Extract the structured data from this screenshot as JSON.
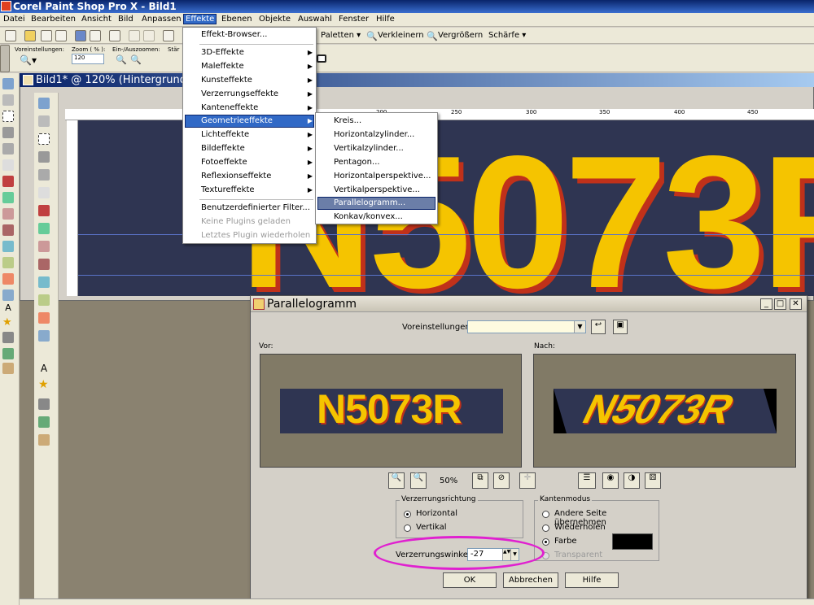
{
  "app": {
    "title": "Corel Paint Shop Pro X - Bild1"
  },
  "menubar": [
    "Datei",
    "Bearbeiten",
    "Ansicht",
    "Bild",
    "Anpassen",
    "Effekte",
    "Ebenen",
    "Objekte",
    "Auswahl",
    "Fenster",
    "Hilfe"
  ],
  "toolbar1": {
    "paletten": "Paletten ▾",
    "verkleinern": "Verkleinern",
    "vergroessern": "Vergrößern",
    "schaerfe": "Schärfe ▾"
  },
  "toolbar2": {
    "presets_label": "Voreinstellungen:",
    "zoom_label": "Zoom ( % ):",
    "zoom_value": "120",
    "zoominout_label": "Ein-/Auszoomen:",
    "staerke_label": "Stär"
  },
  "document": {
    "title": "Bild1* @ 120% (Hintergrund",
    "plate_text": "N5073R"
  },
  "ruler_ticks": [
    "200",
    "250",
    "300",
    "350",
    "400",
    "450"
  ],
  "effects_menu": {
    "items": [
      "Effekt-Browser...",
      "3D-Effekte",
      "Maleffekte",
      "Kunsteffekte",
      "Verzerrungseffekte",
      "Kanteneffekte",
      "Geometrieeffekte",
      "Lichteffekte",
      "Bildeffekte",
      "Fotoeffekte",
      "Reflexionseffekte",
      "Textureffekte",
      "Benutzerdefinierter Filter...",
      "Keine Plugins geladen",
      "Letztes Plugin wiederholen"
    ]
  },
  "geometry_menu": {
    "items": [
      "Kreis...",
      "Horizontalzylinder...",
      "Vertikalzylinder...",
      "Pentagon...",
      "Horizontalperspektive...",
      "Vertikalperspektive...",
      "Parallelogramm...",
      "Konkav/konvex..."
    ]
  },
  "dialog": {
    "title": "Parallelogramm",
    "presets_label": "Voreinstellungen:",
    "before_label": "Vor:",
    "after_label": "Nach:",
    "zoom": "50%",
    "direction_group": "Verzerrungsrichtung",
    "horizontal": "Horizontal",
    "vertical": "Vertikal",
    "edge_group": "Kantenmodus",
    "edge_opt1": "Andere Seite übernehmen",
    "edge_opt2": "Wiederholen",
    "edge_opt3": "Farbe",
    "edge_opt4": "Transparent",
    "angle_label": "Verzerrungswinkel:",
    "angle_value": "-27",
    "ok": "OK",
    "cancel": "Abbrechen",
    "help": "Hilfe",
    "fill_color": "#000000"
  }
}
